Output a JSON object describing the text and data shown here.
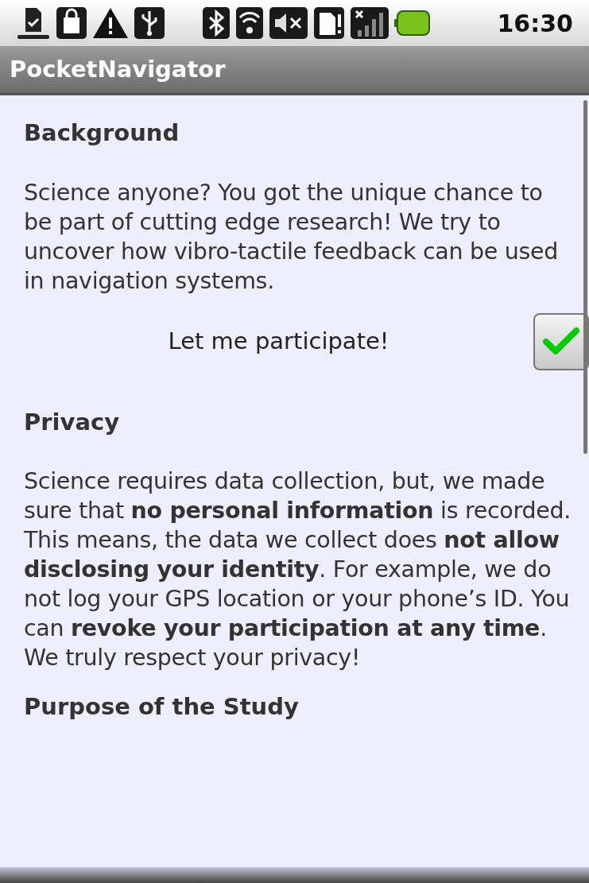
{
  "status_bar": {
    "time": "16:30"
  },
  "app_bar": {
    "title": "PocketNavigator"
  },
  "sections": [
    {
      "kind": "heading",
      "text": "Background"
    },
    {
      "kind": "paragraph",
      "text": "Science anyone? You got the unique chance to be part of cutting edge research! We try to uncover how vibro-tactile feedback can be used in navigation systems."
    },
    {
      "kind": "checkbox",
      "text": "Let me participate!",
      "checked": true
    },
    {
      "kind": "heading",
      "text": "Privacy"
    },
    {
      "kind": "paragraph",
      "text": "Science requires data collection, but, we made sure that **no personal information** is recorded. This means, the data we collect does **not allow disclosing your identity**. For example, we do not log your GPS location or your phone’s ID. You can **revoke your participation at any time**. We truly respect your privacy!"
    },
    {
      "kind": "heading",
      "text": "Purpose of the Study"
    }
  ]
}
